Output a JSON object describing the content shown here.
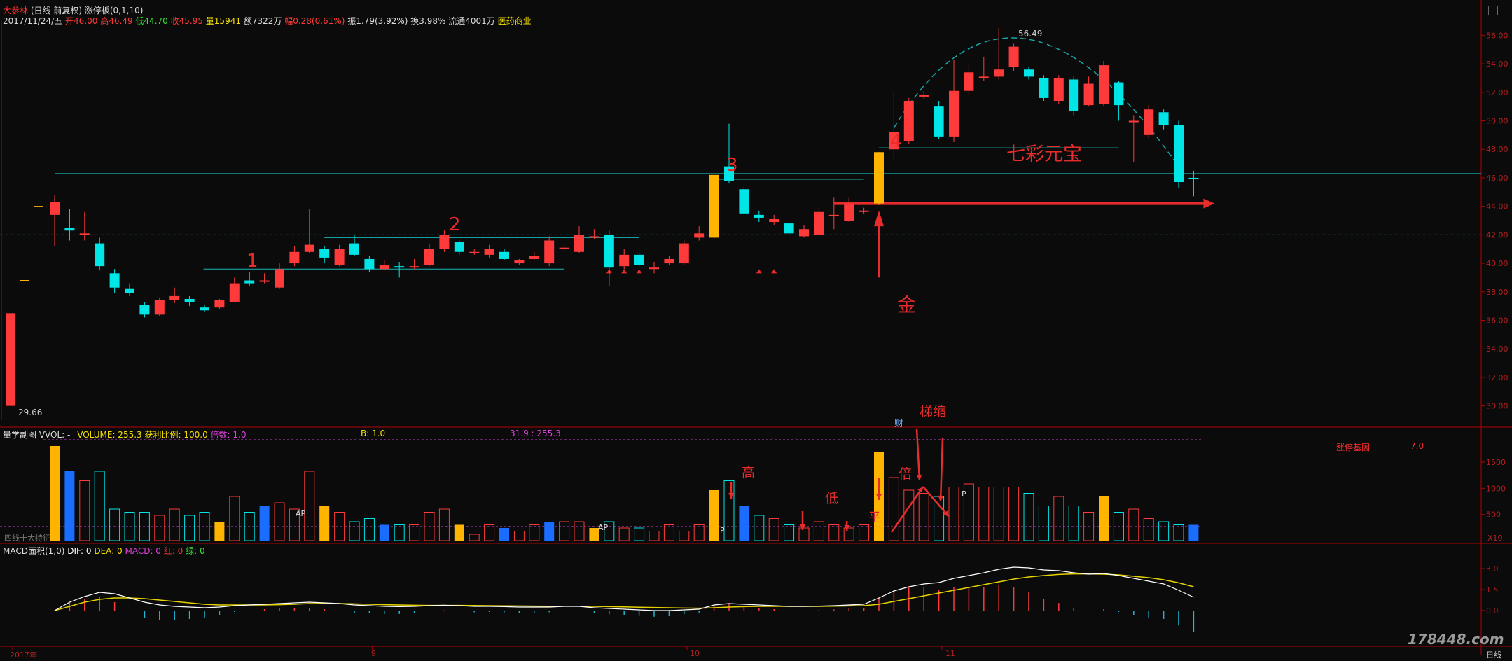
{
  "header": {
    "stock_name": "大参林",
    "period": "(日线 前复权)",
    "indicator_title": "涨停板(0,1,10)",
    "date": "2017/11/24/五",
    "open": "开46.00",
    "high": "高46.49",
    "low": "低44.70",
    "close": "收45.95",
    "volume": "量15941",
    "amount": "额7322万",
    "change": "幅0.28(0.61%)",
    "amplitude": "振1.79(3.92%)",
    "turnover": "换3.98%",
    "float_shares": "流通4001万",
    "industry": "医药商业"
  },
  "panels": {
    "volume": {
      "title": "量学副图",
      "vvol": "VVOL: -",
      "volume": "VOLUME: 255.3",
      "ratio": "获利比例: 100.0",
      "multiple": "倍数: 1.0",
      "b": "B: 1.0",
      "range": "31.9 : 255.3",
      "limit_label": "涨停基因",
      "limit_value": "7.0",
      "left_label": "四线十大特征",
      "scale_label": "X10"
    },
    "macd": {
      "title": "MACD面积(1,0)",
      "dif": "DIF: 0",
      "dea": "DEA: 0",
      "macd": "MACD: 0",
      "red": "红: 0",
      "green": "绿: 0"
    }
  },
  "annotations": {
    "n1": "1",
    "n2": "2",
    "n3": "3",
    "n4": "4",
    "gold": "金",
    "yuanbao": "七彩元宝",
    "high": "高",
    "low": "低",
    "flat": "平",
    "double": "倍",
    "shrink": "梯缩",
    "cai": "财",
    "ap": "AP",
    "p": "P",
    "peak_price": "56.49",
    "low_price": "29.66"
  },
  "x_labels": [
    "2017年",
    "9",
    "10",
    "11",
    "日线"
  ],
  "watermark": "178448.com",
  "colors": {
    "background": "#0b0b0b",
    "up": "#ff3a3a",
    "down": "#00e5e5",
    "gold": "#ffb400",
    "blue": "#1a6dff",
    "axis": "#b30000",
    "grid_text": "#b32020",
    "annotation": "#e82b2b",
    "dif": "#ffffff",
    "dea": "#e6d200"
  },
  "chart_data": {
    "type": "candlestick",
    "price_axis": {
      "ticks": [
        30,
        32,
        34,
        36,
        38,
        40,
        42,
        44,
        46,
        48,
        50,
        52,
        54,
        56
      ],
      "ylim": [
        29,
        57
      ]
    },
    "candles": [
      {
        "o": 43.4,
        "c": 44.3,
        "h": 44.8,
        "l": 42.5
      },
      {
        "o": 42.5,
        "c": 42.3,
        "h": 43.8,
        "l": 41.6
      },
      {
        "o": 42.0,
        "c": 42.1,
        "h": 43.6,
        "l": 41.6
      },
      {
        "o": 41.4,
        "c": 39.8,
        "h": 41.8,
        "l": 39.5
      },
      {
        "o": 39.3,
        "c": 38.3,
        "h": 39.6,
        "l": 37.9
      },
      {
        "o": 38.2,
        "c": 37.9,
        "h": 38.6,
        "l": 37.7
      },
      {
        "o": 37.1,
        "c": 36.4,
        "h": 37.3,
        "l": 36.2
      },
      {
        "o": 36.4,
        "c": 37.4,
        "h": 37.6,
        "l": 36.3
      },
      {
        "o": 37.4,
        "c": 37.7,
        "h": 38.3,
        "l": 37.2
      },
      {
        "o": 37.5,
        "c": 37.3,
        "h": 37.7,
        "l": 37.0
      },
      {
        "o": 36.9,
        "c": 36.7,
        "h": 37.1,
        "l": 36.6
      },
      {
        "o": 36.9,
        "c": 37.4,
        "h": 37.5,
        "l": 36.8
      },
      {
        "o": 37.3,
        "c": 38.6,
        "h": 39.0,
        "l": 37.3
      },
      {
        "o": 38.8,
        "c": 38.6,
        "h": 39.4,
        "l": 38.4
      },
      {
        "o": 38.7,
        "c": 38.8,
        "h": 39.3,
        "l": 38.6
      },
      {
        "o": 38.3,
        "c": 39.6,
        "h": 40.0,
        "l": 38.2
      },
      {
        "o": 40.0,
        "c": 40.8,
        "h": 41.2,
        "l": 39.8
      },
      {
        "o": 40.8,
        "c": 41.3,
        "h": 43.8,
        "l": 40.7
      },
      {
        "o": 41.0,
        "c": 40.4,
        "h": 41.2,
        "l": 40.0
      },
      {
        "o": 39.9,
        "c": 41.0,
        "h": 41.3,
        "l": 39.8
      },
      {
        "o": 41.4,
        "c": 40.6,
        "h": 42.0,
        "l": 40.5
      },
      {
        "o": 40.3,
        "c": 39.6,
        "h": 40.5,
        "l": 39.4
      },
      {
        "o": 39.6,
        "c": 39.9,
        "h": 40.2,
        "l": 39.5
      },
      {
        "o": 39.8,
        "c": 39.7,
        "h": 40.1,
        "l": 39.0
      },
      {
        "o": 39.8,
        "c": 39.8,
        "h": 40.3,
        "l": 39.6
      },
      {
        "o": 39.9,
        "c": 41.0,
        "h": 41.4,
        "l": 39.8
      },
      {
        "o": 41.0,
        "c": 42.0,
        "h": 42.3,
        "l": 40.8
      },
      {
        "o": 41.5,
        "c": 40.8,
        "h": 41.6,
        "l": 40.6
      },
      {
        "o": 40.8,
        "c": 40.8,
        "h": 41.0,
        "l": 40.6
      },
      {
        "o": 40.6,
        "c": 41.0,
        "h": 41.3,
        "l": 40.4
      },
      {
        "o": 40.8,
        "c": 40.3,
        "h": 41.0,
        "l": 40.2
      },
      {
        "o": 40.0,
        "c": 40.2,
        "h": 40.3,
        "l": 39.9
      },
      {
        "o": 40.3,
        "c": 40.5,
        "h": 40.8,
        "l": 40.2
      },
      {
        "o": 40.0,
        "c": 41.6,
        "h": 41.9,
        "l": 39.8
      },
      {
        "o": 41.1,
        "c": 41.1,
        "h": 41.4,
        "l": 40.8
      },
      {
        "o": 40.8,
        "c": 42.0,
        "h": 42.6,
        "l": 40.7
      },
      {
        "o": 41.9,
        "c": 41.9,
        "h": 42.4,
        "l": 41.7
      },
      {
        "o": 42.0,
        "c": 39.7,
        "h": 42.3,
        "l": 38.4
      },
      {
        "o": 39.8,
        "c": 40.6,
        "h": 41.0,
        "l": 39.6
      },
      {
        "o": 40.6,
        "c": 39.9,
        "h": 40.8,
        "l": 39.7
      },
      {
        "o": 39.6,
        "c": 39.7,
        "h": 40.1,
        "l": 39.3
      },
      {
        "o": 40.0,
        "c": 40.3,
        "h": 40.5,
        "l": 39.9
      },
      {
        "o": 40.0,
        "c": 41.4,
        "h": 41.6,
        "l": 39.9
      },
      {
        "o": 41.8,
        "c": 42.1,
        "h": 42.6,
        "l": 41.6
      },
      {
        "o": 41.8,
        "c": 46.2,
        "h": 46.2,
        "l": 41.7
      },
      {
        "o": 46.8,
        "c": 45.8,
        "h": 49.8,
        "l": 45.6
      },
      {
        "o": 45.2,
        "c": 43.5,
        "h": 45.4,
        "l": 43.4
      },
      {
        "o": 43.4,
        "c": 43.2,
        "h": 43.7,
        "l": 42.9
      },
      {
        "o": 42.9,
        "c": 43.1,
        "h": 43.4,
        "l": 42.7
      },
      {
        "o": 42.8,
        "c": 42.1,
        "h": 42.9,
        "l": 41.9
      },
      {
        "o": 41.9,
        "c": 42.4,
        "h": 42.7,
        "l": 41.8
      },
      {
        "o": 42.0,
        "c": 43.6,
        "h": 43.9,
        "l": 41.9
      },
      {
        "o": 43.4,
        "c": 43.4,
        "h": 44.6,
        "l": 42.4
      },
      {
        "o": 43.0,
        "c": 44.2,
        "h": 44.6,
        "l": 42.9
      },
      {
        "o": 43.7,
        "c": 43.7,
        "h": 43.9,
        "l": 43.5
      },
      {
        "o": 44.2,
        "c": 47.8,
        "h": 47.8,
        "l": 44.1
      },
      {
        "o": 48.0,
        "c": 49.2,
        "h": 52.0,
        "l": 47.3
      },
      {
        "o": 48.6,
        "c": 51.4,
        "h": 51.6,
        "l": 48.4
      },
      {
        "o": 51.7,
        "c": 51.8,
        "h": 52.1,
        "l": 51.5
      },
      {
        "o": 51.0,
        "c": 48.9,
        "h": 51.4,
        "l": 48.7
      },
      {
        "o": 48.9,
        "c": 52.1,
        "h": 54.3,
        "l": 48.5
      },
      {
        "o": 52.1,
        "c": 53.4,
        "h": 53.9,
        "l": 51.8
      },
      {
        "o": 53.1,
        "c": 53.1,
        "h": 54.5,
        "l": 52.8
      },
      {
        "o": 53.1,
        "c": 53.6,
        "h": 56.5,
        "l": 52.9
      },
      {
        "o": 53.8,
        "c": 55.2,
        "h": 55.4,
        "l": 53.5
      },
      {
        "o": 53.6,
        "c": 53.1,
        "h": 53.8,
        "l": 52.9
      },
      {
        "o": 53.0,
        "c": 51.6,
        "h": 53.2,
        "l": 51.4
      },
      {
        "o": 51.4,
        "c": 53.0,
        "h": 53.2,
        "l": 51.2
      },
      {
        "o": 52.9,
        "c": 50.7,
        "h": 53.1,
        "l": 50.4
      },
      {
        "o": 51.1,
        "c": 52.6,
        "h": 53.1,
        "l": 51.0
      },
      {
        "o": 51.2,
        "c": 53.9,
        "h": 54.2,
        "l": 51.0
      },
      {
        "o": 52.7,
        "c": 51.1,
        "h": 52.8,
        "l": 50.0
      },
      {
        "o": 50.0,
        "c": 50.0,
        "h": 50.4,
        "l": 47.1
      },
      {
        "o": 49.0,
        "c": 50.8,
        "h": 51.1,
        "l": 48.8
      },
      {
        "o": 50.6,
        "c": 49.7,
        "h": 50.8,
        "l": 49.4
      },
      {
        "o": 49.7,
        "c": 45.7,
        "h": 50.0,
        "l": 45.3
      },
      {
        "o": 46.0,
        "c": 45.9,
        "h": 46.5,
        "l": 44.7
      }
    ],
    "gold_candles": [
      44,
      55
    ],
    "volume": [
      3.0,
      2.2,
      1.9,
      2.2,
      1.0,
      0.9,
      0.9,
      0.8,
      1.0,
      0.8,
      0.9,
      0.6,
      1.4,
      0.9,
      1.1,
      1.2,
      1.0,
      2.2,
      1.1,
      0.9,
      0.6,
      0.7,
      0.5,
      0.5,
      0.5,
      0.9,
      1.0,
      0.5,
      0.2,
      0.5,
      0.4,
      0.3,
      0.5,
      0.6,
      0.6,
      0.6,
      0.4,
      0.6,
      0.4,
      0.4,
      0.3,
      0.5,
      0.3,
      0.5,
      1.6,
      1.9,
      1.1,
      0.8,
      0.7,
      0.5,
      0.4,
      0.6,
      0.5,
      0.4,
      0.5,
      2.8,
      2.0,
      1.6,
      1.5,
      1.4,
      1.7,
      1.8,
      1.7,
      1.7,
      1.7,
      1.5,
      1.1,
      1.4,
      1.1,
      0.9,
      1.4,
      0.9,
      1.0,
      0.7,
      0.6,
      0.5,
      0.5
    ],
    "volume_axis": {
      "ticks": [
        500,
        1000,
        1500
      ],
      "labels": [
        "500",
        "1000",
        "1500"
      ]
    },
    "volume_gold": [
      0,
      11,
      18,
      27,
      36,
      44,
      55,
      70
    ],
    "volume_blue": [
      1,
      14,
      22,
      30,
      33,
      46,
      76
    ],
    "dif": [
      0.0,
      0.6,
      1.0,
      1.3,
      1.2,
      0.9,
      0.6,
      0.4,
      0.3,
      0.25,
      0.2,
      0.25,
      0.35,
      0.4,
      0.45,
      0.5,
      0.55,
      0.6,
      0.55,
      0.5,
      0.4,
      0.35,
      0.3,
      0.28,
      0.3,
      0.35,
      0.38,
      0.35,
      0.3,
      0.3,
      0.28,
      0.25,
      0.25,
      0.25,
      0.3,
      0.3,
      0.2,
      0.15,
      0.1,
      0.05,
      0.0,
      0.0,
      0.05,
      0.1,
      0.4,
      0.5,
      0.45,
      0.4,
      0.35,
      0.3,
      0.3,
      0.32,
      0.35,
      0.4,
      0.45,
      0.9,
      1.4,
      1.7,
      1.9,
      2.0,
      2.3,
      2.5,
      2.7,
      2.95,
      3.1,
      3.05,
      2.9,
      2.85,
      2.7,
      2.6,
      2.65,
      2.5,
      2.3,
      2.1,
      1.9,
      1.45,
      0.95
    ],
    "dea": [
      0.0,
      0.3,
      0.6,
      0.8,
      0.9,
      0.9,
      0.85,
      0.75,
      0.65,
      0.55,
      0.45,
      0.4,
      0.4,
      0.4,
      0.4,
      0.42,
      0.45,
      0.5,
      0.5,
      0.5,
      0.48,
      0.45,
      0.42,
      0.4,
      0.38,
      0.37,
      0.37,
      0.37,
      0.36,
      0.35,
      0.34,
      0.33,
      0.32,
      0.31,
      0.31,
      0.31,
      0.3,
      0.28,
      0.26,
      0.24,
      0.22,
      0.2,
      0.18,
      0.17,
      0.2,
      0.25,
      0.28,
      0.3,
      0.3,
      0.3,
      0.3,
      0.3,
      0.31,
      0.33,
      0.35,
      0.45,
      0.65,
      0.85,
      1.05,
      1.25,
      1.45,
      1.65,
      1.85,
      2.05,
      2.25,
      2.4,
      2.5,
      2.58,
      2.62,
      2.62,
      2.6,
      2.55,
      2.45,
      2.35,
      2.2,
      1.98,
      1.7
    ],
    "macd_axis": {
      "ticks": [
        0,
        1.5,
        3
      ],
      "labels": [
        "0.0",
        "1.5",
        "3.0"
      ]
    },
    "x_ticks": [
      {
        "label": "2017年",
        "i": 0
      },
      {
        "label": "9",
        "i": 24
      },
      {
        "label": "10",
        "i": 45
      },
      {
        "label": "11",
        "i": 62
      }
    ]
  }
}
